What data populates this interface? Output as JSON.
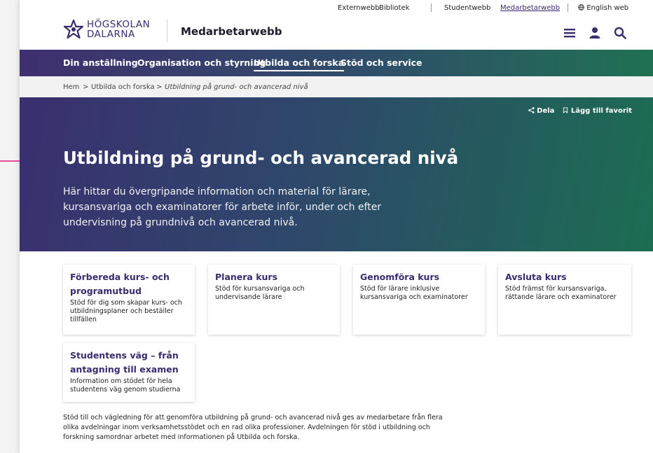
{
  "utility": {
    "links": [
      "Externwebb",
      "Bibliotek",
      "Studentwebb",
      "Medarbetarwebb",
      "English web"
    ]
  },
  "header": {
    "logo_line1": "HÖGSKOLAN",
    "logo_line2": "DALARNA",
    "site_name": "Medarbetarwebb",
    "icons": [
      "menu-icon",
      "user-icon",
      "search-icon"
    ]
  },
  "mainnav": {
    "items": [
      "Din anställning",
      "Organisation och styrning",
      "Utbilda och forska",
      "Stöd och service"
    ]
  },
  "breadcrumb": {
    "items": [
      "Hem",
      "Utbilda och forska",
      "Utbildning på grund- och avancerad nivå"
    ],
    "separator": ">"
  },
  "hero": {
    "share": "Dela",
    "favorite": "Lägg till favorit",
    "title": "Utbildning på grund- och avancerad nivå",
    "lead": "Här hittar du övergripande information och material för lärare, kursansvariga och examinatorer för arbete inför, under och efter undervisning på grundnivå och avancerad nivå."
  },
  "cards": [
    {
      "title": "Förbereda kurs- och programutbud",
      "text": "Stöd för dig som skapar kurs- och utbildningsplaner och beställer tillfällen"
    },
    {
      "title": "Planera kurs",
      "text": "Stöd för kursansvariga och undervisande lärare"
    },
    {
      "title": "Genomföra kurs",
      "text": "Stöd för lärare inklusive kursansvariga och examinatorer"
    },
    {
      "title": "Avsluta kurs",
      "text": "Stöd främst för kursansvariga, rättande lärare och examinatorer"
    },
    {
      "title": "Studentens väg – från antagning till examen",
      "text": "Information om stödet för hela studentens väg genom studierna"
    }
  ],
  "footer_text": "Stöd till och vägledning för att genomföra utbildning på grund- och avancerad nivå ges av medarbetare från flera olika avdelningar inom verksamhetsstödet och en rad olika professioner. Avdelningen för stöd i utbildning och forskning samordnar arbetet med informationen på Utbilda och forska.",
  "colors": {
    "brand_purple": "#3a2c6e",
    "brand_green": "#1c6d52",
    "annotation_arrow": "#e0187a"
  }
}
